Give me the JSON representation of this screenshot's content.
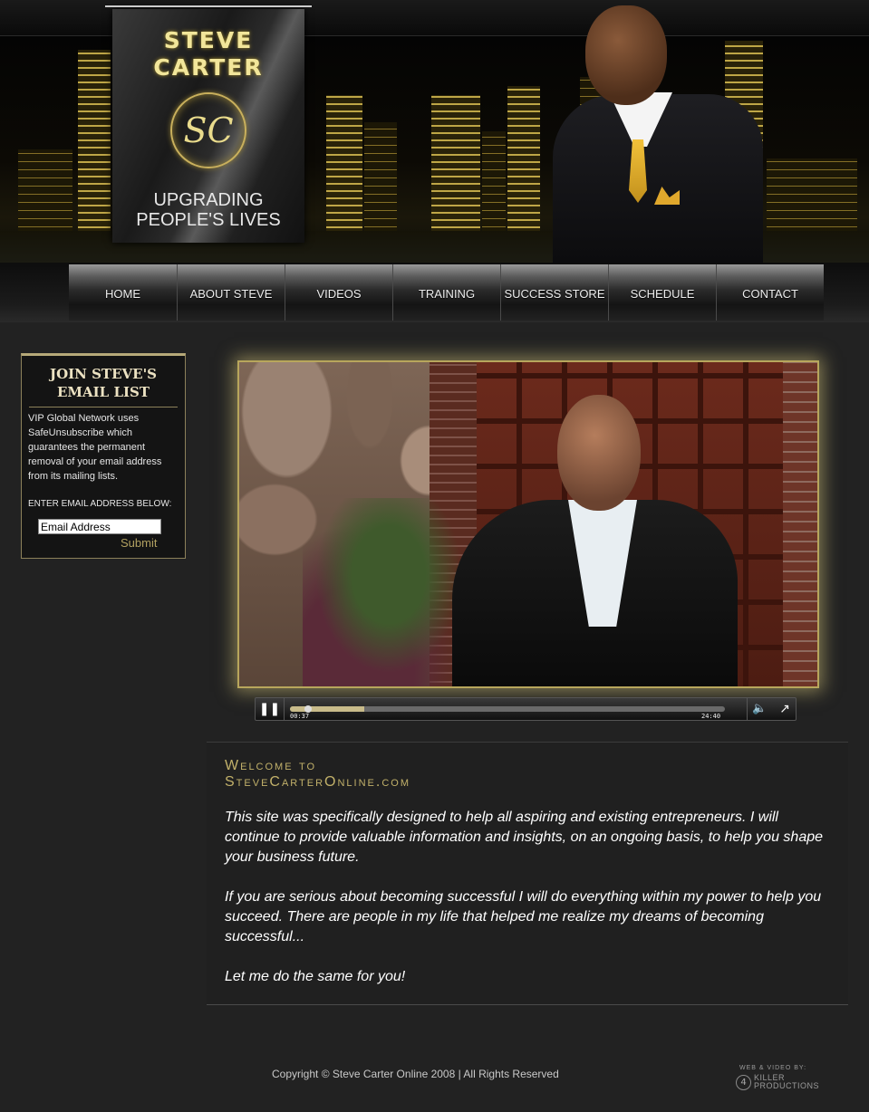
{
  "header": {
    "title": "STEVE CARTER",
    "monogram": "SC",
    "tagline_line1": "UPGRADING",
    "tagline_line2": "PEOPLE'S LIVES"
  },
  "nav": {
    "items": [
      {
        "label": "HOME"
      },
      {
        "label": "ABOUT STEVE"
      },
      {
        "label": "VIDEOS"
      },
      {
        "label": "TRAINING"
      },
      {
        "label": "SUCCESS STORE"
      },
      {
        "label": "SCHEDULE"
      },
      {
        "label": "CONTACT"
      }
    ]
  },
  "email_signup": {
    "heading": "JOIN STEVE'S EMAIL LIST",
    "description": "VIP Global Network uses SafeUnsubscribe which guarantees the permanent removal of your email address from its mailing lists.",
    "input_label": "ENTER EMAIL ADDRESS BELOW:",
    "input_value": "Email Address",
    "submit_label": "Submit"
  },
  "video_player": {
    "pause_icon": "pause-icon",
    "time_current": "00:37",
    "time_total": "24:40",
    "progress_fraction": 0.17,
    "volume_icon": "volume-icon",
    "fullscreen_icon": "fullscreen-icon"
  },
  "welcome": {
    "title_line1": "Welcome to",
    "title_line2": "SteveCarterOnline.com",
    "paragraphs": [
      "This site was specifically designed to help all aspiring and existing entrepreneurs. I will continue to provide valuable information and insights, on an ongoing basis, to help you shape your business future.",
      "If you are serious about becoming successful I will do everything within my power to help you succeed. There are people in my life that helped me realize my dreams of becoming successful...",
      "Let me do the same for you!"
    ]
  },
  "footer": {
    "copyright": "Copyright © Steve Carter Online 2008 | All Rights Reserved",
    "credit_label": "WEB & VIDEO BY:",
    "credit_line1": "KILLER",
    "credit_line2": "PRODUCTIONS"
  },
  "colors": {
    "background": "#222222",
    "gold_accent": "#c2b16a",
    "box_border": "#8c815a"
  }
}
